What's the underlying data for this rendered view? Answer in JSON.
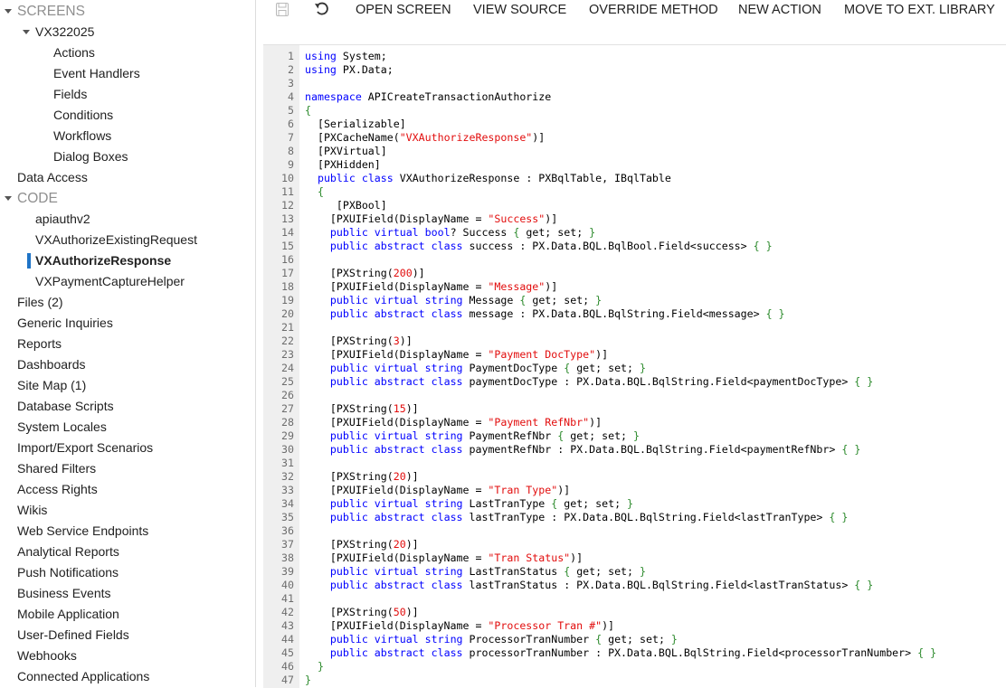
{
  "sidebar": {
    "items": [
      {
        "label": "SCREENS",
        "section": true,
        "caret": true,
        "indent": 0
      },
      {
        "label": "VX322025",
        "caret": true,
        "indent": 1
      },
      {
        "label": "Actions",
        "indent": 2
      },
      {
        "label": "Event Handlers",
        "indent": 2
      },
      {
        "label": "Fields",
        "indent": 2
      },
      {
        "label": "Conditions",
        "indent": 2
      },
      {
        "label": "Workflows",
        "indent": 2
      },
      {
        "label": "Dialog Boxes",
        "indent": 2
      },
      {
        "label": "Data Access",
        "indent": 0
      },
      {
        "label": "CODE",
        "section": true,
        "caret": true,
        "indent": 0
      },
      {
        "label": "apiauthv2",
        "indent": 1
      },
      {
        "label": "VXAuthorizeExistingRequest",
        "indent": 1
      },
      {
        "label": "VXAuthorizeResponse",
        "indent": 1,
        "active": true
      },
      {
        "label": "VXPaymentCaptureHelper",
        "indent": 1
      },
      {
        "label": "Files (2)",
        "indent": 0
      },
      {
        "label": "Generic Inquiries",
        "indent": 0
      },
      {
        "label": "Reports",
        "indent": 0
      },
      {
        "label": "Dashboards",
        "indent": 0
      },
      {
        "label": "Site Map (1)",
        "indent": 0
      },
      {
        "label": "Database Scripts",
        "indent": 0
      },
      {
        "label": "System Locales",
        "indent": 0
      },
      {
        "label": "Import/Export Scenarios",
        "indent": 0
      },
      {
        "label": "Shared Filters",
        "indent": 0
      },
      {
        "label": "Access Rights",
        "indent": 0
      },
      {
        "label": "Wikis",
        "indent": 0
      },
      {
        "label": "Web Service Endpoints",
        "indent": 0
      },
      {
        "label": "Analytical Reports",
        "indent": 0
      },
      {
        "label": "Push Notifications",
        "indent": 0
      },
      {
        "label": "Business Events",
        "indent": 0
      },
      {
        "label": "Mobile Application",
        "indent": 0
      },
      {
        "label": "User-Defined Fields",
        "indent": 0
      },
      {
        "label": "Webhooks",
        "indent": 0
      },
      {
        "label": "Connected Applications",
        "indent": 0
      }
    ]
  },
  "toolbar": {
    "save_icon": "save-icon",
    "undo_icon": "undo-icon",
    "buttons": [
      "OPEN SCREEN",
      "VIEW SOURCE",
      "OVERRIDE METHOD",
      "NEW ACTION",
      "MOVE TO EXT. LIBRARY"
    ]
  },
  "editor": {
    "lines": [
      "using System;",
      "using PX.Data;",
      "",
      "namespace APICreateTransactionAuthorize",
      "{",
      "  [Serializable]",
      "  [PXCacheName(\"VXAuthorizeResponse\")]",
      "  [PXVirtual]",
      "  [PXHidden]",
      "  public class VXAuthorizeResponse : PXBqlTable, IBqlTable",
      "  {",
      "     [PXBool]",
      "    [PXUIField(DisplayName = \"Success\")]",
      "    public virtual bool? Success { get; set; }",
      "    public abstract class success : PX.Data.BQL.BqlBool.Field<success> { }",
      "",
      "    [PXString(200)]",
      "    [PXUIField(DisplayName = \"Message\")]",
      "    public virtual string Message { get; set; }",
      "    public abstract class message : PX.Data.BQL.BqlString.Field<message> { }",
      "",
      "    [PXString(3)]",
      "    [PXUIField(DisplayName = \"Payment DocType\")]",
      "    public virtual string PaymentDocType { get; set; }",
      "    public abstract class paymentDocType : PX.Data.BQL.BqlString.Field<paymentDocType> { }",
      "",
      "    [PXString(15)]",
      "    [PXUIField(DisplayName = \"Payment RefNbr\")]",
      "    public virtual string PaymentRefNbr { get; set; }",
      "    public abstract class paymentRefNbr : PX.Data.BQL.BqlString.Field<paymentRefNbr> { }",
      "",
      "    [PXString(20)]",
      "    [PXUIField(DisplayName = \"Tran Type\")]",
      "    public virtual string LastTranType { get; set; }",
      "    public abstract class lastTranType : PX.Data.BQL.BqlString.Field<lastTranType> { }",
      "",
      "    [PXString(20)]",
      "    [PXUIField(DisplayName = \"Tran Status\")]",
      "    public virtual string LastTranStatus { get; set; }",
      "    public abstract class lastTranStatus : PX.Data.BQL.BqlString.Field<lastTranStatus> { }",
      "",
      "    [PXString(50)]",
      "    [PXUIField(DisplayName = \"Processor Tran #\")]",
      "    public virtual string ProcessorTranNumber { get; set; }",
      "    public abstract class processorTranNumber : PX.Data.BQL.BqlString.Field<processorTranNumber> { }",
      "  }",
      "}"
    ]
  },
  "colors": {
    "keyword": "#0000ff",
    "string": "#e20d0d",
    "brace": "#2e8b2e",
    "active_bar": "#1f74c7",
    "section": "#8f8f8f"
  }
}
